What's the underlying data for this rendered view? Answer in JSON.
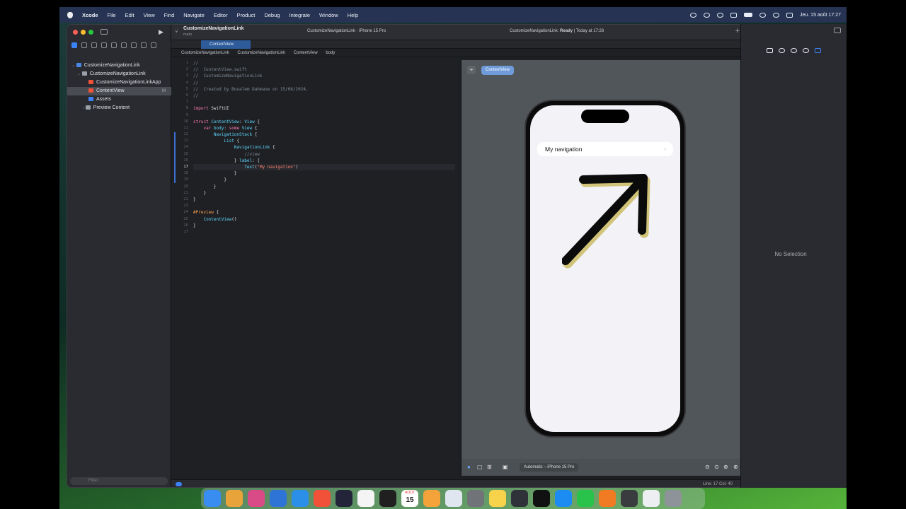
{
  "menubar": {
    "app": "Xcode",
    "items": [
      "File",
      "Edit",
      "View",
      "Find",
      "Navigate",
      "Editor",
      "Product",
      "Debug",
      "Integrate",
      "Window",
      "Help"
    ],
    "clock": "Jeu. 15 août 17:27"
  },
  "sidebar": {
    "tree": [
      {
        "label": "CustomizeNavigationLink",
        "indent": 0,
        "icon": "project-icon"
      },
      {
        "label": "CustomizeNavigationLink",
        "indent": 1,
        "icon": "folder-icon"
      },
      {
        "label": "CustomizeNavigationLinkApp",
        "indent": 2,
        "icon": "swift-file-icon"
      },
      {
        "label": "ContentView",
        "indent": 2,
        "icon": "swift-file-icon",
        "selected": true,
        "badge": "M"
      },
      {
        "label": "Assets",
        "indent": 2,
        "icon": "assets-icon"
      },
      {
        "label": "Preview Content",
        "indent": 2,
        "icon": "folder-icon"
      }
    ],
    "filter_placeholder": "Filter"
  },
  "toolbar": {
    "project": "CustomizeNavigationLink",
    "branch": "main",
    "scheme": "CustomizeNavigationLink",
    "device": "iPhone 15 Pro",
    "status_prefix": "CustomizeNavigationLink: ",
    "status_ready": "Ready",
    "status_time": " | Today at 17:26"
  },
  "tab": {
    "label": "ContentView"
  },
  "jumpbar": [
    "CustomizeNavigationLink",
    "CustomizeNavigationLink",
    "ContentView",
    "body"
  ],
  "editor": {
    "line_numbers": [
      "1",
      "2",
      "3",
      "4",
      "5",
      "6",
      "7",
      "8",
      "9",
      "10",
      "11",
      "12",
      "13",
      "14",
      "15",
      "16",
      "17",
      "18",
      "19",
      "20",
      "21",
      "22",
      "23",
      "24",
      "25",
      "26",
      "27"
    ],
    "current_line": "17"
  },
  "canvas": {
    "tag": "ContentView",
    "device_selector": "Automatic – iPhone 15 Pro"
  },
  "preview": {
    "nav_label": "My navigation"
  },
  "inspector": {
    "empty": "No Selection"
  },
  "statusbar": {
    "position": "Line: 17  Col: 40"
  },
  "dock": {
    "calendar_month": "AOÛT",
    "calendar_day": "15"
  }
}
